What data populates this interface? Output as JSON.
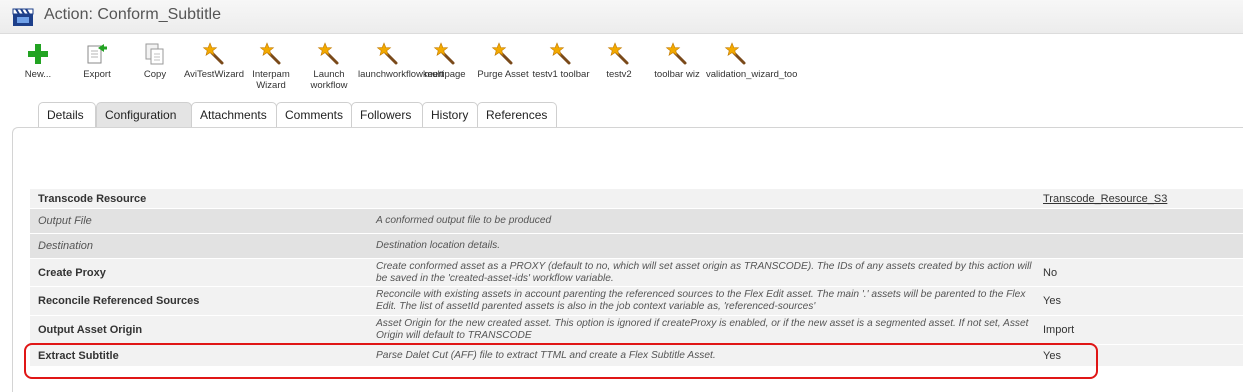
{
  "window": {
    "title": "Action: Conform_Subtitle",
    "icon": "clapperboard-icon"
  },
  "toolbar": {
    "buttons": [
      {
        "label": "New...",
        "icon": "plus-icon"
      },
      {
        "label": "Export",
        "icon": "export-icon"
      },
      {
        "label": "Copy",
        "icon": "copy-icon"
      },
      {
        "label": "AviTestWizard",
        "icon": "magic-wand-icon"
      },
      {
        "label": "Interpam Wizard",
        "icon": "magic-wand-icon"
      },
      {
        "label": "Launch workflow",
        "icon": "magic-wand-icon"
      },
      {
        "label": "launchworkflowkeert",
        "icon": "magic-wand-icon"
      },
      {
        "label": "multipage",
        "icon": "magic-wand-icon"
      },
      {
        "label": "Purge Asset",
        "icon": "magic-wand-icon"
      },
      {
        "label": "testv1 toolbar",
        "icon": "magic-wand-icon"
      },
      {
        "label": "testv2",
        "icon": "magic-wand-icon"
      },
      {
        "label": "toolbar wiz",
        "icon": "magic-wand-icon"
      },
      {
        "label": "validation_wizard_too",
        "icon": "magic-wand-icon"
      }
    ]
  },
  "tabs": [
    {
      "label": "Details",
      "active": false
    },
    {
      "label": "Configuration",
      "active": true
    },
    {
      "label": "Attachments",
      "active": false
    },
    {
      "label": "Comments",
      "active": false
    },
    {
      "label": "Followers",
      "active": false
    },
    {
      "label": "History",
      "active": false
    },
    {
      "label": "References",
      "active": false
    }
  ],
  "config_rows": [
    {
      "name": "Transcode Resource",
      "description": "",
      "value": "Transcode_Resource_S3",
      "value_is_link": true
    },
    {
      "name": "Output File",
      "description": "A conformed output file to be produced",
      "value": ""
    },
    {
      "name": "Destination",
      "description": "Destination location details.",
      "value": ""
    },
    {
      "name": "Create Proxy",
      "description": "Create conformed asset as a PROXY (default to no, which will set asset origin as TRANSCODE). The IDs of any assets created by this action will be saved in the 'created-asset-ids' workflow variable.",
      "value": "No"
    },
    {
      "name": "Reconcile Referenced Sources",
      "description": "Reconcile with existing assets in account parenting the referenced sources to the Flex Edit asset. The main '.' assets will be parented to the Flex Edit. The list of assetId parented assets is also in the job context variable as, 'referenced-sources'",
      "value": "Yes"
    },
    {
      "name": "Output Asset Origin",
      "description": "Asset Origin for the new created asset. This option is ignored if createProxy is enabled, or if the new asset is a segmented asset. If not set, Asset Origin will default to TRANSCODE",
      "value": "Import"
    },
    {
      "name": "Extract Subtitle",
      "description": "Parse Dalet Cut (AFF) file to extract TTML and create a Flex Subtitle Asset.",
      "value": "Yes"
    }
  ],
  "colors": {
    "highlight": "#e01616",
    "wand_star": "#f2a900",
    "plus": "#22a322"
  }
}
